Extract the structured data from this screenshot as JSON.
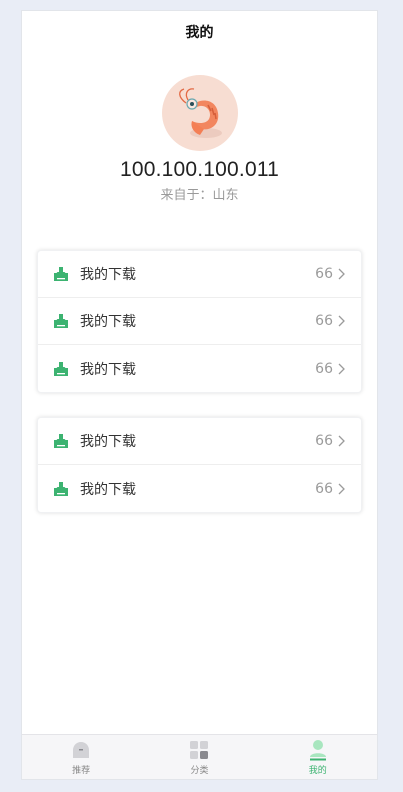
{
  "header": {
    "title": "我的"
  },
  "profile": {
    "ip": "100.100.100.011",
    "location": "来自于：山东"
  },
  "groups": [
    {
      "items": [
        {
          "label": "我的下载",
          "count": "66",
          "icon": "download-icon"
        },
        {
          "label": "我的下载",
          "count": "66",
          "icon": "download-icon"
        },
        {
          "label": "我的下载",
          "count": "66",
          "icon": "download-icon"
        }
      ]
    },
    {
      "items": [
        {
          "label": "我的下载",
          "count": "66",
          "icon": "download-icon"
        },
        {
          "label": "我的下载",
          "count": "66",
          "icon": "download-icon"
        }
      ]
    }
  ],
  "tabbar": {
    "tabs": [
      {
        "label": "推荐",
        "icon": "home-icon",
        "active": false
      },
      {
        "label": "分类",
        "icon": "category-icon",
        "active": false
      },
      {
        "label": "我的",
        "icon": "user-icon",
        "active": true
      }
    ]
  },
  "colors": {
    "accent": "#3cb371",
    "background": "#e9edf6"
  }
}
